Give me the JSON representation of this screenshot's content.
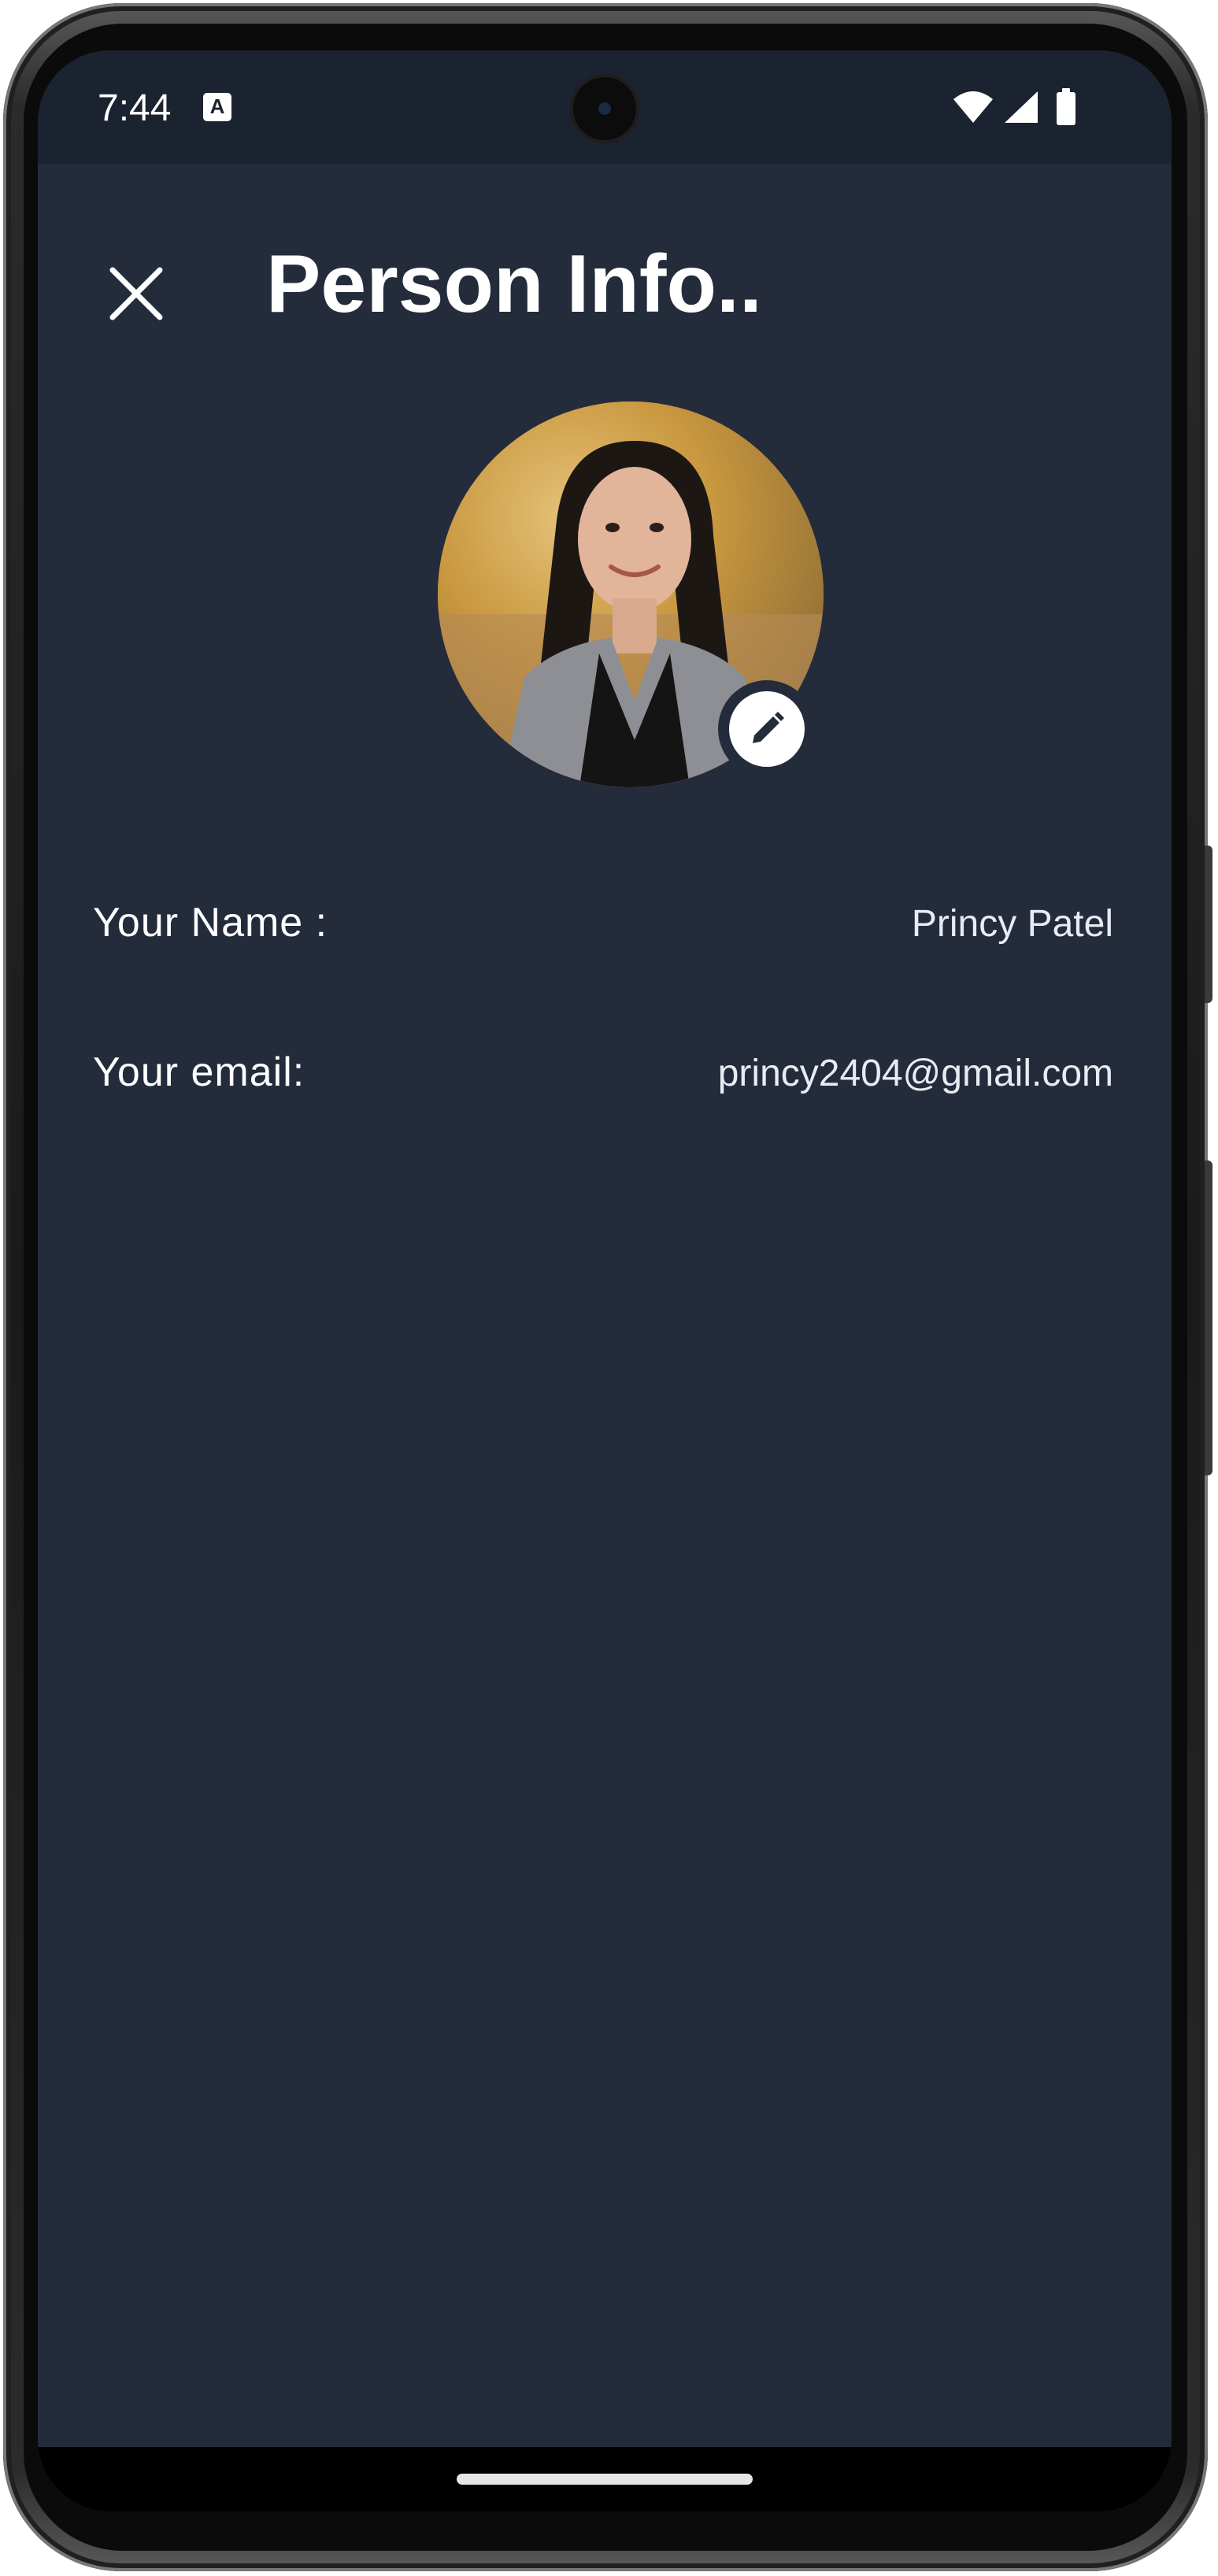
{
  "status_bar": {
    "time": "7:44",
    "notification_glyph": "A",
    "icons": [
      "wifi-icon",
      "signal-icon",
      "battery-icon"
    ]
  },
  "app_bar": {
    "title": "Person Info..",
    "close_icon": "close-icon"
  },
  "profile": {
    "avatar_alt": "profile photo",
    "edit_icon": "pencil-icon"
  },
  "fields": {
    "name": {
      "label": "Your Name :",
      "value": "Princy Patel"
    },
    "email": {
      "label": "Your email:",
      "value": "princy2404@gmail.com"
    }
  },
  "colors": {
    "screen_background": "#242c3b",
    "status_bar_background": "#1c2330",
    "text_primary": "#ffffff",
    "nav_bar": "#000000"
  }
}
